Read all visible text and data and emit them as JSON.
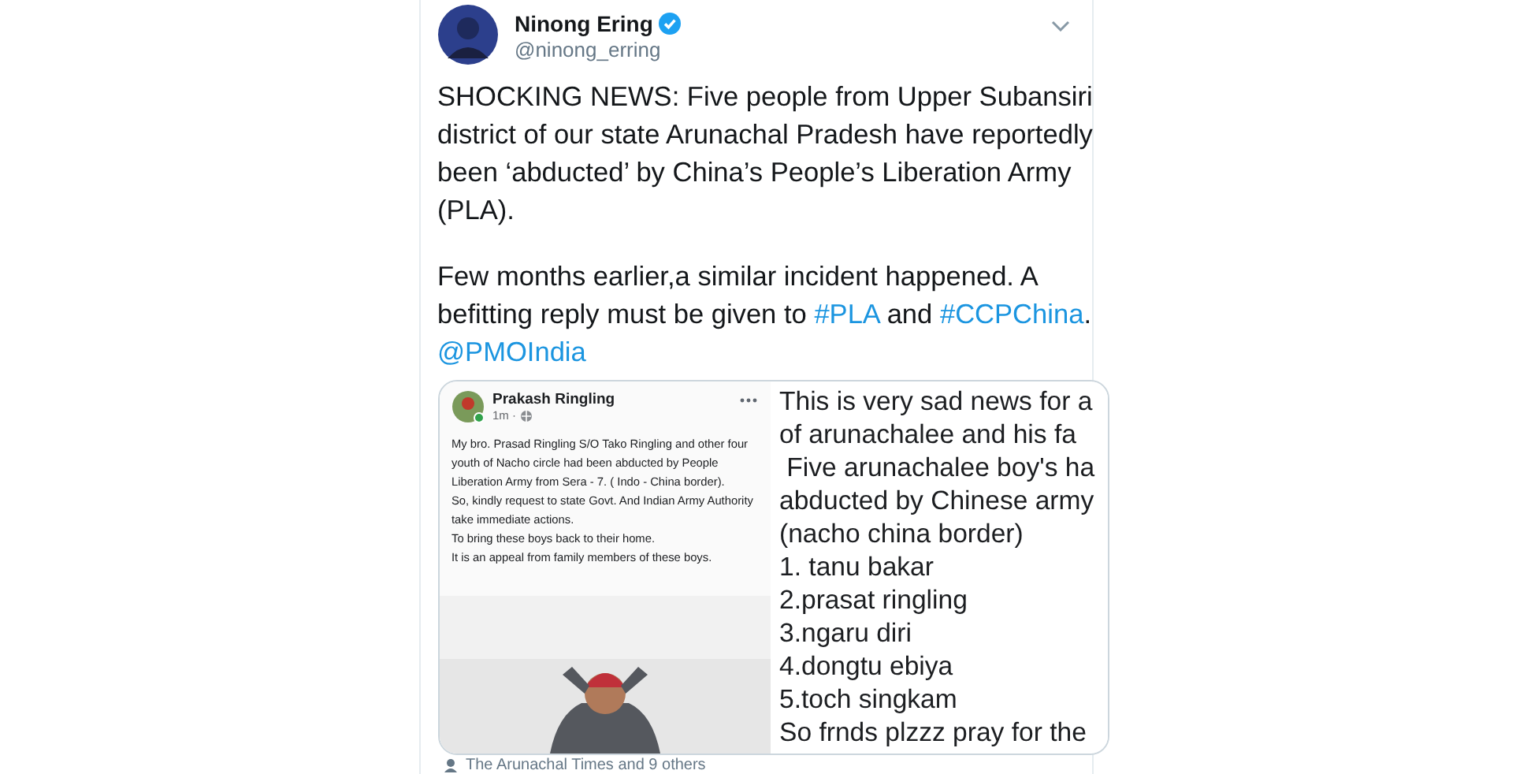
{
  "tweet": {
    "author": {
      "name": "Ninong Ering",
      "verified": true,
      "handle": "@ninong_erring"
    },
    "paragraphs": [
      [
        {
          "kind": "text",
          "text": "SHOCKING NEWS: Five people from Upper Subansiri district of our state Arunachal Pradesh have reportedly been ‘abducted’ by China’s People’s Liberation Army (PLA)."
        }
      ],
      [
        {
          "kind": "text",
          "text": "Few months earlier,a similar incident happened. A befitting reply must be given to "
        },
        {
          "kind": "link",
          "text": "#PLA"
        },
        {
          "kind": "text",
          "text": " and "
        },
        {
          "kind": "link",
          "text": "#CCPChina"
        },
        {
          "kind": "text",
          "text": "."
        },
        {
          "kind": "mention",
          "text": "@PMOIndia"
        }
      ]
    ],
    "media": {
      "fb_post": {
        "author": "Prakash Ringling",
        "online": true,
        "time": "1m ·",
        "body": "My bro. Prasad Ringling S/O Tako Ringling and other four youth of Nacho circle had been abducted by People Liberation Army from Sera - 7. ( Indo - China border).\nSo, kindly request to state Govt. And Indian Army Authority take immediate actions.\nTo bring these boys back to their home.\nIt is an appeal from family members of these boys."
      },
      "note_lines": [
        "This is very sad news for a",
        "of arunachalee and his fa",
        " Five arunachalee boy's ha",
        "abducted by Chinese army",
        "(nacho china border)",
        "1. tanu bakar",
        "2.prasat ringling",
        "3.ngaru diri",
        "4.dongtu ebiya",
        "5.toch singkam",
        "So frnds plzzz pray for the"
      ]
    },
    "tagged": "The Arunachal Times and 9 others"
  }
}
